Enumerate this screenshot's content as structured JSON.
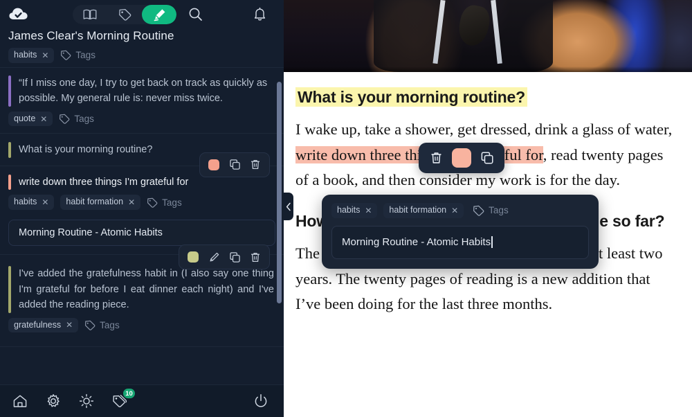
{
  "sidebar": {
    "topbar": {
      "logo_icon": "cloud-check-icon",
      "tabs": [
        {
          "icon": "book-icon",
          "name": "book",
          "active": false
        },
        {
          "icon": "tag-icon",
          "name": "tag",
          "active": false
        },
        {
          "icon": "highlighter-icon",
          "name": "highlighter",
          "active": true
        }
      ],
      "search_icon": "search-icon",
      "bell_icon": "bell-icon"
    },
    "title": "James Clear's Morning Routine",
    "doc_tags": [
      {
        "label": "habits"
      }
    ],
    "tags_add_label": "Tags",
    "notes": [
      {
        "accent": "#8b6fc4",
        "text": "“If I miss one day, I try to get back on track as quickly as possible. My general rule is: never miss twice.",
        "tags": [
          {
            "label": "quote"
          }
        ],
        "tags_add_label": "Tags"
      },
      {
        "accent": "#a3a86b",
        "text": "What is your morning routine?",
        "tags": [],
        "tags_add_label": ""
      },
      {
        "accent": "#f4a08c",
        "text": "write down three things I'm grateful for",
        "tags": [
          {
            "label": "habits"
          },
          {
            "label": "habit formation"
          }
        ],
        "tags_add_label": "Tags",
        "title_box": "Morning Routine - Atomic Habits",
        "actions": [
          "swatch",
          "copy-icon",
          "trash-icon"
        ],
        "swatch_color": "#f4a08c"
      },
      {
        "accent": "#a3a86b",
        "text": "I've added the gratefulness habit in (I also say one thing I'm grateful for before I eat dinner each night) and I've added the reading piece.",
        "tags": [
          {
            "label": "gratefulness"
          }
        ],
        "tags_add_label": "Tags",
        "actions": [
          "swatch",
          "pencil-icon",
          "copy-icon",
          "trash-icon"
        ],
        "swatch_color": "#c7cb8a"
      }
    ],
    "bottom_bar": {
      "home_icon": "home-icon",
      "settings_icon": "gear-icon",
      "brightness_icon": "sun-icon",
      "tags_stack_icon": "tags-stack-icon",
      "tags_badge": "10",
      "power_icon": "power-icon"
    }
  },
  "main": {
    "hero_image_alt": "speaker-photo",
    "collapse_icon": "chevron-left-icon",
    "heading_1": "What is your morning routine?",
    "paragraph_1_a": "I wake up, take a shower, get dressed, drink a glass of water, ",
    "paragraph_1_highlight": "write down three things I’m grateful for",
    "paragraph_1_b": ", read twenty pages of a book, and then consider my work is for the day.",
    "heading_2": "How long have you stuck with this routine so far?",
    "paragraph_2": "The majority of the routine I’ve been doing for at least two years. The twenty pages of reading is a new addition that I’ve been doing for the last three months.",
    "float_toolbar": {
      "trash_icon": "trash-icon",
      "swatch_color": "#f8b39f",
      "copy_icon": "copy-icon"
    },
    "tag_popup": {
      "tags": [
        {
          "label": "habits"
        },
        {
          "label": "habit formation"
        }
      ],
      "tags_add_label": "Tags",
      "input_value": "Morning Routine - Atomic Habits"
    }
  },
  "colors": {
    "accent_green": "#10b981",
    "sidebar_bg": "#141e2e",
    "highlight_yellow": "#fbf5ad",
    "highlight_salmon": "#f8bcab"
  }
}
